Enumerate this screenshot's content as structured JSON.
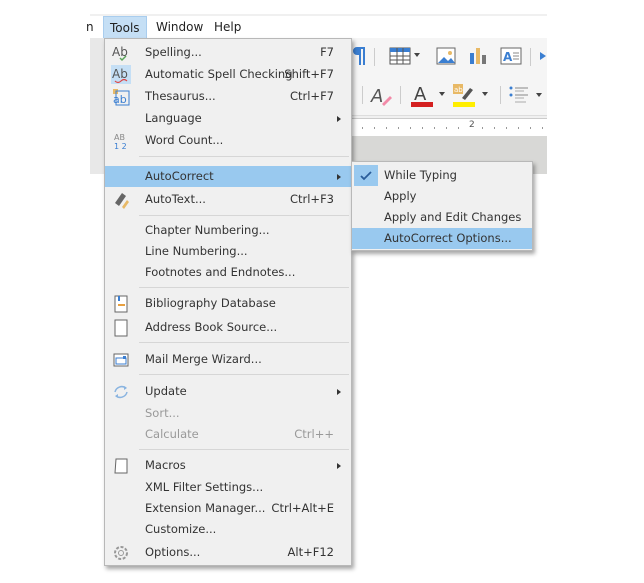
{
  "menubar": {
    "partial_left": "n",
    "items": [
      {
        "label": "Tools",
        "active": true
      },
      {
        "label": "Window",
        "active": false
      },
      {
        "label": "Help",
        "active": false
      }
    ]
  },
  "toolbar": {
    "row1_icons": [
      "formatting-marks-icon",
      "insert-table-icon",
      "insert-image-icon",
      "insert-chart-icon",
      "insert-textbox-icon"
    ],
    "row2_icons": [
      "clear-formatting-icon",
      "font-color-icon",
      "highlighting-color-icon",
      "list-icon"
    ],
    "font_color": "#d42020",
    "highlight_color": "#ffee00"
  },
  "ruler": {
    "mark": "2"
  },
  "tools_menu": {
    "items": [
      {
        "label": "Spelling...",
        "shortcut": "F7",
        "icon": "spelling-icon"
      },
      {
        "label": "Automatic Spell Checking",
        "shortcut": "Shift+F7",
        "icon": "auto-spellcheck-icon",
        "checked": true
      },
      {
        "label": "Thesaurus...",
        "shortcut": "Ctrl+F7",
        "icon": "thesaurus-icon"
      },
      {
        "label": "Language",
        "shortcut": "",
        "submenu": true
      },
      {
        "label": "Word Count...",
        "shortcut": "",
        "icon": "word-count-icon"
      },
      {
        "label": "AutoCorrect",
        "shortcut": "",
        "submenu": true,
        "highlighted": true
      },
      {
        "label": "AutoText...",
        "shortcut": "Ctrl+F3",
        "icon": "autotext-icon"
      },
      {
        "label": "Chapter Numbering...",
        "shortcut": ""
      },
      {
        "label": "Line Numbering...",
        "shortcut": ""
      },
      {
        "label": "Footnotes and Endnotes...",
        "shortcut": ""
      },
      {
        "label": "Bibliography Database",
        "shortcut": "",
        "icon": "bibliography-icon"
      },
      {
        "label": "Address Book Source...",
        "shortcut": "",
        "icon": "address-book-icon"
      },
      {
        "label": "Mail Merge Wizard...",
        "shortcut": "",
        "icon": "mail-merge-icon"
      },
      {
        "label": "Update",
        "shortcut": "",
        "submenu": true,
        "icon": "update-icon"
      },
      {
        "label": "Sort...",
        "shortcut": "",
        "disabled": true
      },
      {
        "label": "Calculate",
        "shortcut": "Ctrl++",
        "disabled": true
      },
      {
        "label": "Macros",
        "shortcut": "",
        "submenu": true,
        "icon": "macros-icon"
      },
      {
        "label": "XML Filter Settings...",
        "shortcut": ""
      },
      {
        "label": "Extension Manager...",
        "shortcut": "Ctrl+Alt+E"
      },
      {
        "label": "Customize...",
        "shortcut": ""
      },
      {
        "label": "Options...",
        "shortcut": "Alt+F12",
        "icon": "options-gear-icon"
      }
    ]
  },
  "autocorrect_submenu": {
    "items": [
      {
        "label": "While Typing",
        "checked": true
      },
      {
        "label": "Apply"
      },
      {
        "label": "Apply and Edit Changes"
      },
      {
        "label": "AutoCorrect Options...",
        "highlighted": true
      }
    ]
  },
  "colors": {
    "highlight": "#99c9ef",
    "menu_bg": "#f0f0f0",
    "disabled_text": "#999999"
  }
}
